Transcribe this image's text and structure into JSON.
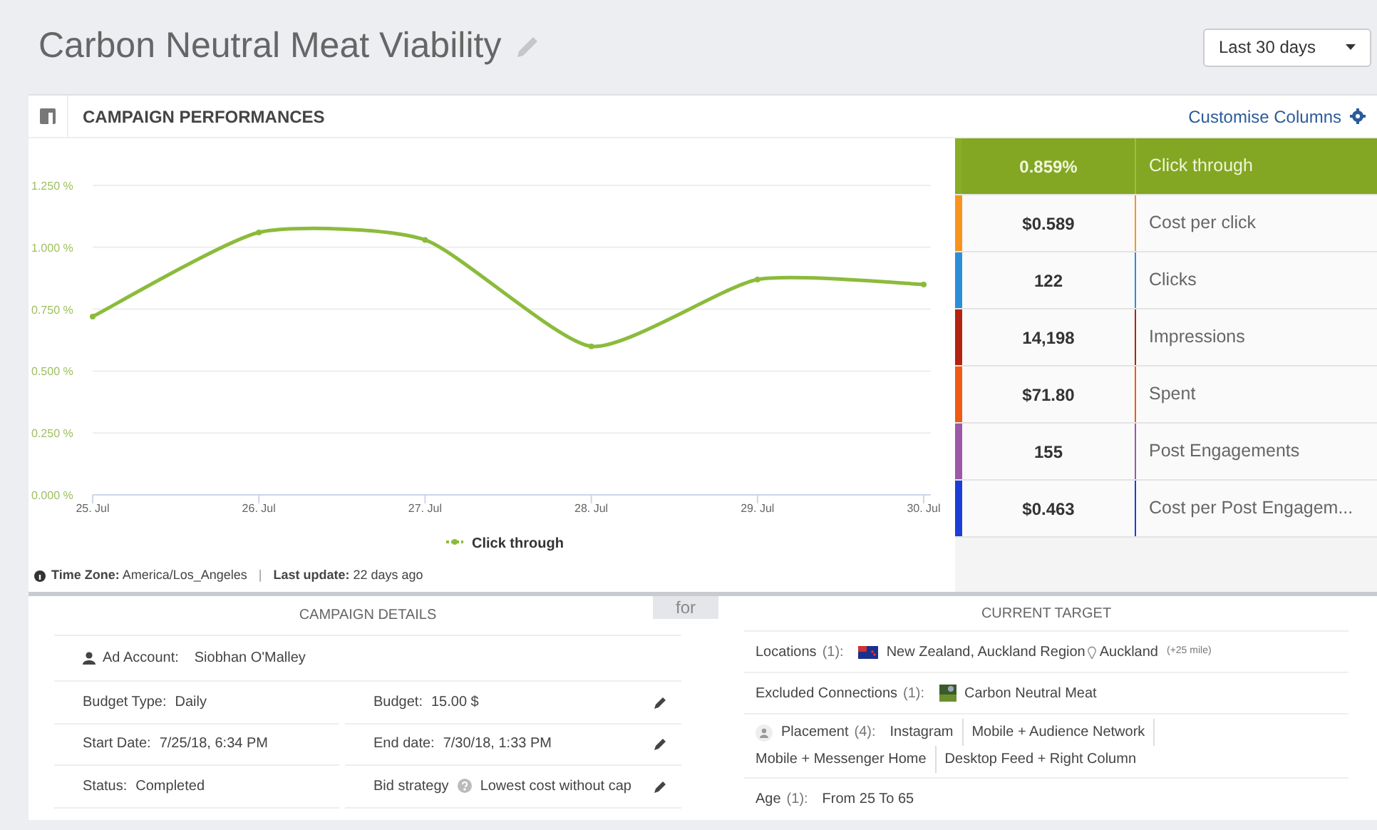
{
  "title": "Carbon Neutral Meat Viability",
  "range_select": {
    "value": "Last 30 days"
  },
  "panel": {
    "title": "CAMPAIGN PERFORMANCES",
    "customise_link": "Customise Columns"
  },
  "chart_data": {
    "type": "line",
    "categories": [
      "25. Jul",
      "26. Jul",
      "27. Jul",
      "28. Jul",
      "29. Jul",
      "30. Jul"
    ],
    "series": [
      {
        "name": "Click through",
        "color": "#8cbb3c",
        "values": [
          0.72,
          1.06,
          1.03,
          0.6,
          0.87,
          0.85
        ]
      }
    ],
    "grid": true,
    "marker": true,
    "ylim": [
      0,
      1.25
    ],
    "yticks": [
      {
        "value": 0,
        "label": "0.000 %"
      },
      {
        "value": 0.25,
        "label": "0.250 %"
      },
      {
        "value": 0.5,
        "label": "0.500 %"
      },
      {
        "value": 0.75,
        "label": "0.750 %"
      },
      {
        "value": 1,
        "label": "1.000 %"
      },
      {
        "value": 1.25,
        "label": "1.250 %"
      }
    ]
  },
  "chart_footer": {
    "time_zone": "**Time Zone:** America/Los_Angeles",
    "separator": "|",
    "last_update": "**Last update:** 22 days ago"
  },
  "metrics": [
    {
      "value": "0.859%",
      "label": "Click through",
      "color": "#86ad25",
      "selected": true
    },
    {
      "value": "$0.589",
      "label": "Cost per click",
      "color": "#f7941d",
      "selected": false
    },
    {
      "value": "122",
      "label": "Clicks",
      "color": "#2a8fd8",
      "selected": false
    },
    {
      "value": "14,198",
      "label": "Impressions",
      "color": "#b3230f",
      "selected": false
    },
    {
      "value": "$71.80",
      "label": "Spent",
      "color": "#ef5a14",
      "selected": false
    },
    {
      "value": "155",
      "label": "Post Engagements",
      "color": "#9b59a6",
      "selected": false
    },
    {
      "value": "$0.463",
      "label": "Cost per Post Engagem...",
      "color": "#1b3fd6",
      "selected": false
    }
  ],
  "connector": "for",
  "campaign_details": {
    "title": "CAMPAIGN DETAILS",
    "account": {
      "label": "Ad Account:",
      "value": "Siobhan O'Malley"
    },
    "rows": [
      [
        {
          "label": "Budget Type:",
          "value": "Daily"
        },
        {
          "label": "Budget:",
          "value": "15.00 $",
          "help": false
        }
      ],
      [
        {
          "label": "Start Date:",
          "value": "7/25/18, 6:34 PM"
        },
        {
          "label": "End date:",
          "value": "7/30/18, 1:33 PM",
          "help": false
        }
      ],
      [
        {
          "label": "Status:",
          "value": "Completed"
        },
        {
          "label": "Bid strategy",
          "value": "Lowest cost without cap",
          "help": true
        }
      ]
    ]
  },
  "current_target": {
    "title": "CURRENT TARGET",
    "rows": [
      {
        "kind": "location",
        "label": "Locations",
        "count": "(1):",
        "region": "New Zealand, Auckland Region",
        "city": "Auckland",
        "radius": "(+25 mile)"
      },
      {
        "kind": "connection",
        "label": "Excluded Connections",
        "count": "(1):",
        "value": "Carbon Neutral Meat"
      },
      {
        "kind": "placement",
        "label": "Placement",
        "count": "(4):",
        "items": [
          "Instagram",
          "Mobile + Audience Network",
          "Mobile + Messenger Home",
          "Desktop Feed + Right Column"
        ]
      },
      {
        "kind": "age",
        "label": "Age",
        "count": "(1):",
        "value": "From 25 To 65"
      }
    ]
  }
}
